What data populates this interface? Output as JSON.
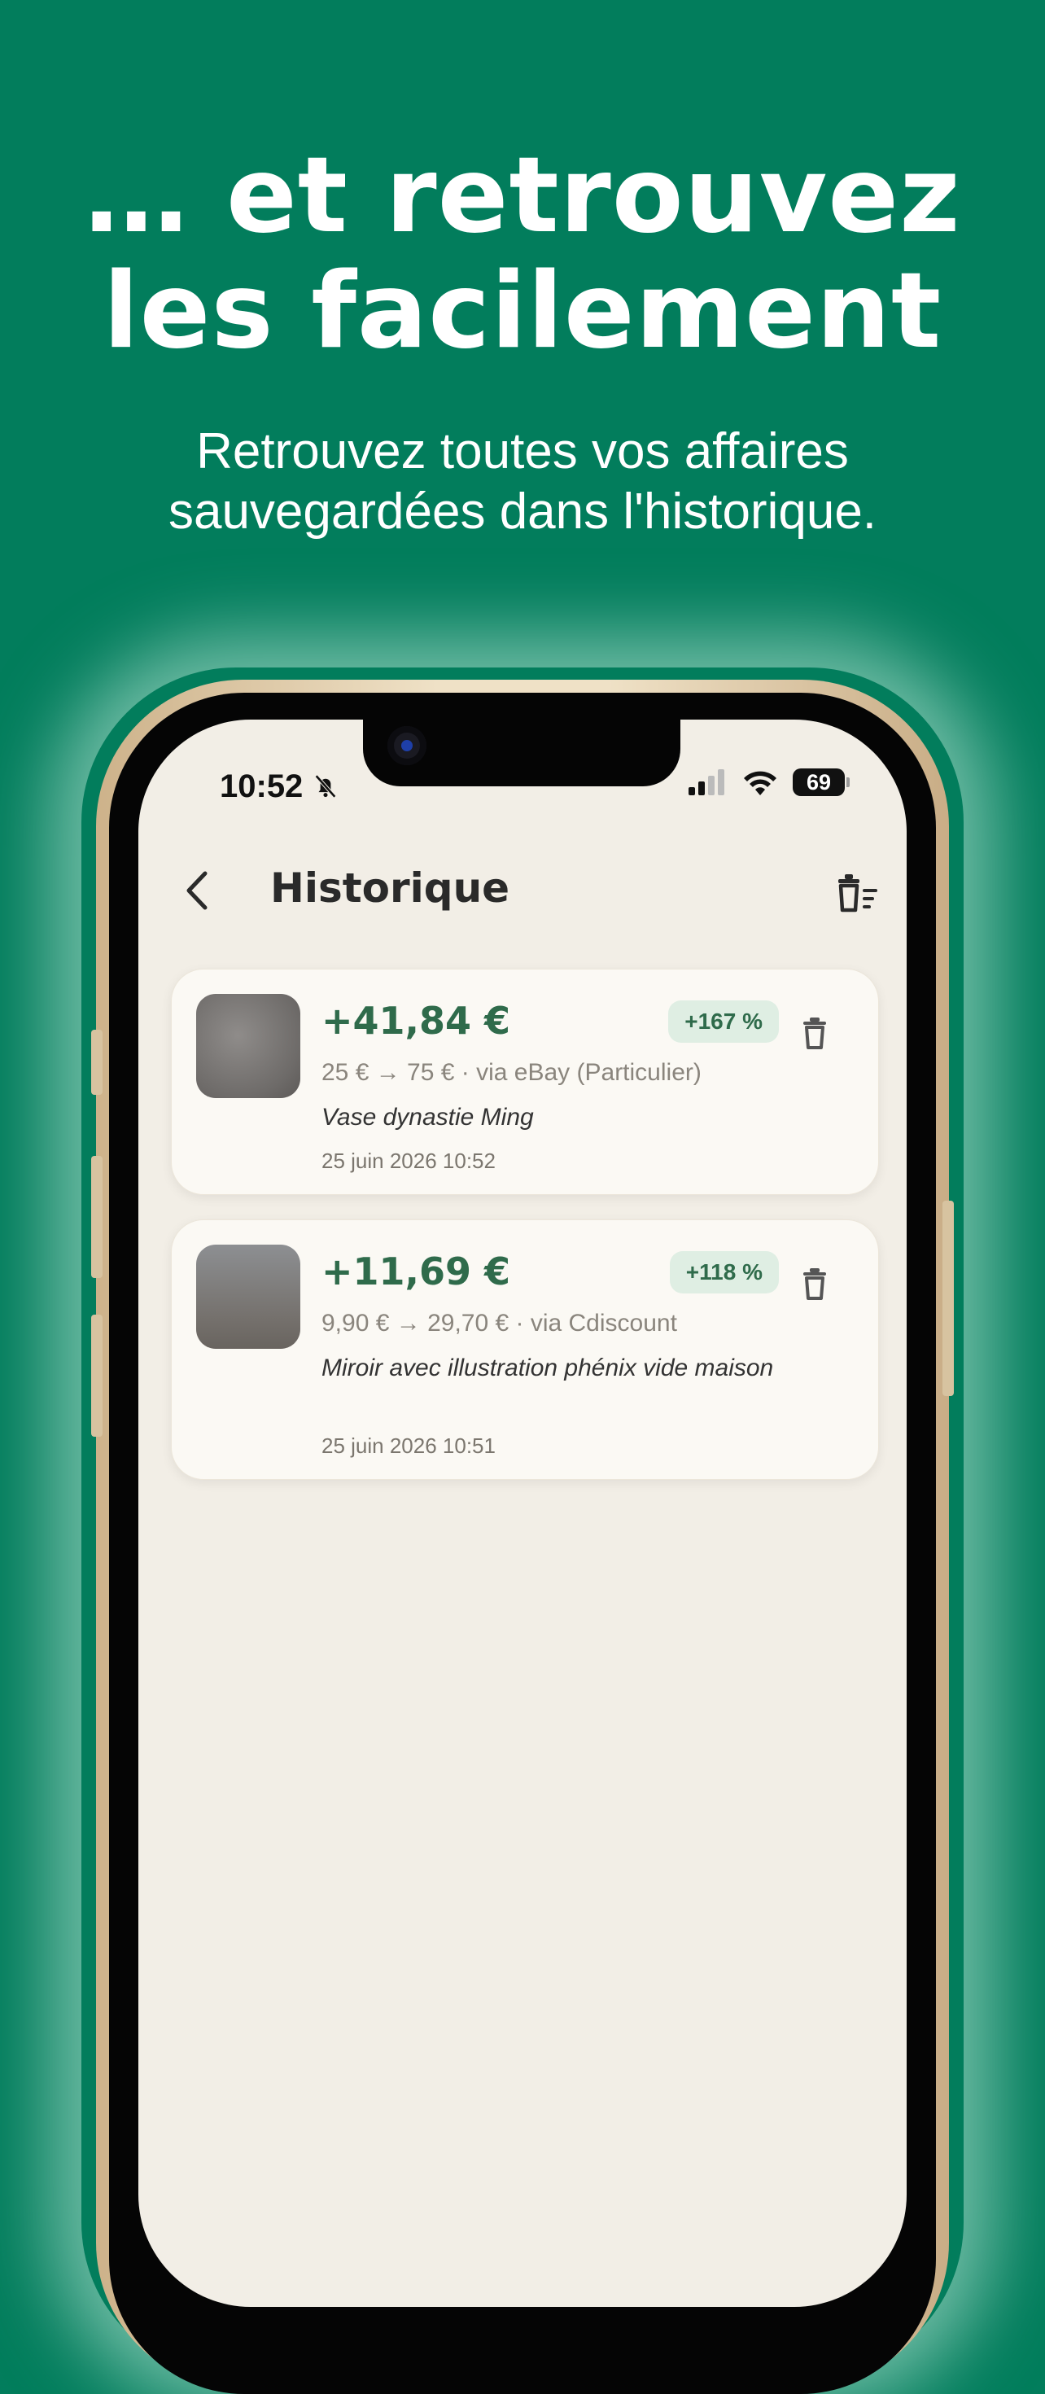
{
  "promo": {
    "headline_line1": "… et retrouvez",
    "headline_line2": "les facilement",
    "subtitle_line1": "Retrouvez toutes vos affaires",
    "subtitle_line2": "sauvegardées dans l'historique."
  },
  "status_bar": {
    "time": "10:52",
    "battery": "69"
  },
  "header": {
    "title": "Historique"
  },
  "history": [
    {
      "profit": "+41,84 €",
      "percent": "+167 %",
      "prices": "25 € → 75 € · via eBay (Particulier)",
      "name": "Vase dynastie Ming",
      "date": "25 juin 2026 10:52"
    },
    {
      "profit": "+11,69 €",
      "percent": "+118 %",
      "prices": "9,90 € → 29,70 € · via Cdiscount",
      "name": "Miroir avec illustration phénix vide maison",
      "date": "25 juin 2026 10:51"
    }
  ],
  "colors": {
    "background": "#027d5c",
    "screen": "#f2eee6",
    "accent_green": "#2f6b4b",
    "badge_bg": "#dfeee3"
  },
  "icons": [
    "back-chevron-icon",
    "clear-history-icon",
    "trash-icon",
    "silent-bell-icon",
    "cellular-signal-icon",
    "wifi-icon",
    "battery-icon"
  ]
}
